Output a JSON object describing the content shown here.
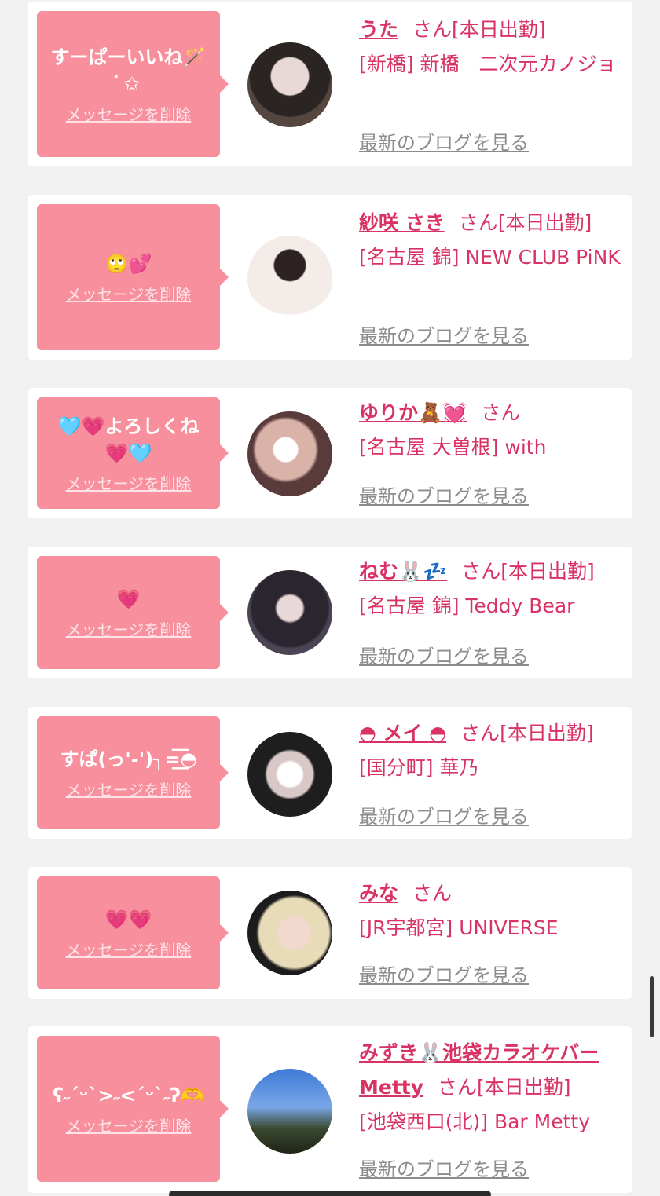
{
  "cards": [
    {
      "message": "すーぱーいいね🪄\n ͘ ✩",
      "delete_label": "メッセージを削除",
      "name": "うた",
      "honorific": "さん",
      "status": "[本日出勤]",
      "location": "[新橋] 新橋　二次元カノジョ",
      "blog_label": "最新のブログを見る"
    },
    {
      "message": "🙄💕",
      "delete_label": "メッセージを削除",
      "name": "紗咲 さき",
      "honorific": "さん",
      "status": "[本日出勤]",
      "location": "[名古屋 錦] NEW CLUB PiNK",
      "blog_label": "最新のブログを見る"
    },
    {
      "message": "🩵💗よろしくね\n💗🩵",
      "delete_label": "メッセージを削除",
      "name": "ゆりか🧸💓",
      "honorific": "さん",
      "status": "",
      "location": "[名古屋 大曽根] with",
      "blog_label": "最新のブログを見る"
    },
    {
      "message": "💗",
      "delete_label": "メッセージを削除",
      "name": "ねむ🐰💤",
      "honorific": "さん",
      "status": "[本日出勤]",
      "location": "[名古屋 錦] Teddy Bear",
      "blog_label": "最新のブログを見る"
    },
    {
      "message": "すぱ(っ'-')╮=͟͟͞͞◓",
      "delete_label": "メッセージを削除",
      "name": "◓ メイ ◓",
      "honorific": "さん",
      "status": "[本日出勤]",
      "location": "[国分町] 華乃",
      "blog_label": "最新のブログを見る"
    },
    {
      "message": "💗💗",
      "delete_label": "メッセージを削除",
      "name": "みな",
      "honorific": "さん",
      "status": "",
      "location": "[JR宇都宮] UNIVERSE",
      "blog_label": "最新のブログを見る"
    },
    {
      "message": "ʕ˶ˊᵕˋ>˶<ˊᵕˋ˶ʔ🫶",
      "delete_label": "メッセージを削除",
      "name": "みずき🐰池袋カラオケバーMetty",
      "honorific": "さん",
      "status": "[本日出勤]",
      "location": "[池袋西口(北)] Bar Metty",
      "blog_label": "最新のブログを見る"
    }
  ],
  "colors": {
    "bubble": "#f7909c",
    "accent": "#d93366",
    "link_gray": "#8c8c8c",
    "background": "#f1f1f1"
  }
}
